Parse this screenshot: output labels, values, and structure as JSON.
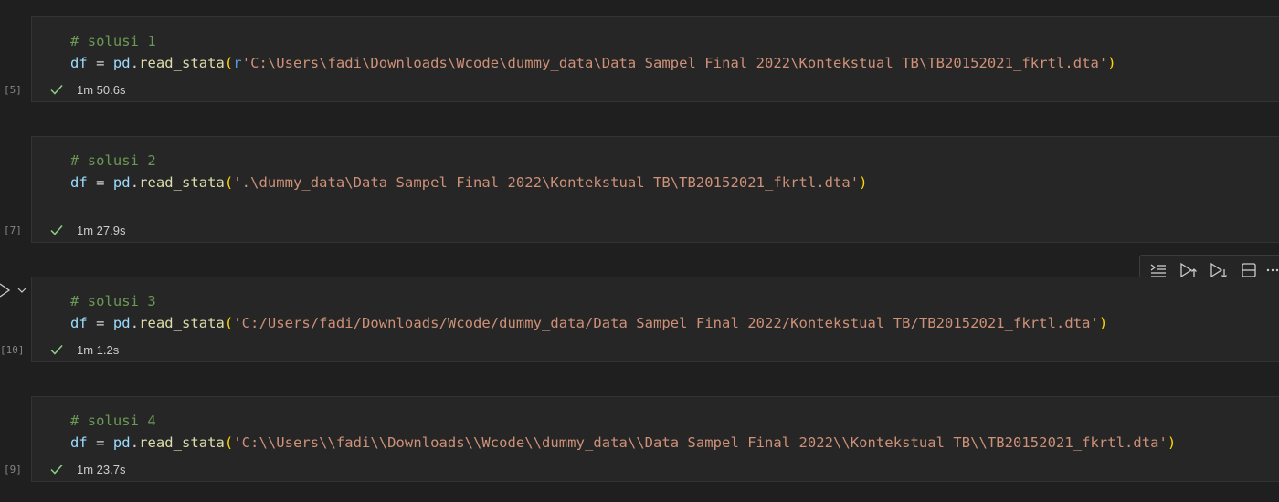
{
  "cells": [
    {
      "comment": "# solusi 1",
      "var": "df",
      "eq": " = ",
      "obj": "pd",
      "dot": ".",
      "fn": "read_stata",
      "open": "(",
      "prefix": "r",
      "str": "'C:\\Users\\fadi\\Downloads\\Wcode\\dummy_data\\Data Sampel Final 2022\\Kontekstual TB\\TB20152021_fkrtl.dta'",
      "close": ")",
      "exec_count": "[5]",
      "duration": "1m 50.6s"
    },
    {
      "comment": "# solusi 2",
      "var": "df",
      "eq": " = ",
      "obj": "pd",
      "dot": ".",
      "fn": "read_stata",
      "open": "(",
      "prefix": "",
      "str": "'.\\dummy_data\\Data Sampel Final 2022\\Kontekstual TB\\TB20152021_fkrtl.dta'",
      "close": ")",
      "exec_count": "[7]",
      "duration": "1m 27.9s"
    },
    {
      "comment": "# solusi 3",
      "var": "df",
      "eq": " = ",
      "obj": "pd",
      "dot": ".",
      "fn": "read_stata",
      "open": "(",
      "prefix": "",
      "str": "'C:/Users/fadi/Downloads/Wcode/dummy_data/Data Sampel Final 2022/Kontekstual TB/TB20152021_fkrtl.dta'",
      "close": ")",
      "exec_count": "[10]",
      "duration": "1m 1.2s"
    },
    {
      "comment": "# solusi 4",
      "var": "df",
      "eq": " = ",
      "obj": "pd",
      "dot": ".",
      "fn": "read_stata",
      "open": "(",
      "prefix": "",
      "str": "'C:\\\\Users\\\\fadi\\\\Downloads\\\\Wcode\\\\dummy_data\\\\Data Sampel Final 2022\\\\Kontekstual TB\\\\TB20152021_fkrtl.dta'",
      "close": ")",
      "exec_count": "[9]",
      "duration": "1m 23.7s"
    }
  ],
  "toolbar": {
    "icons": [
      "execute-above-icon",
      "run-above-icon",
      "run-below-icon",
      "split-cell-icon",
      "more-actions-icon"
    ]
  },
  "colors": {
    "background": "#1f1f1f",
    "cell_bg": "#262626",
    "success_check": "#89d185",
    "comment": "#6a9955",
    "string": "#ce9178",
    "variable": "#9cdcfe",
    "function": "#dcdcaa",
    "bracket": "#ffd700"
  }
}
